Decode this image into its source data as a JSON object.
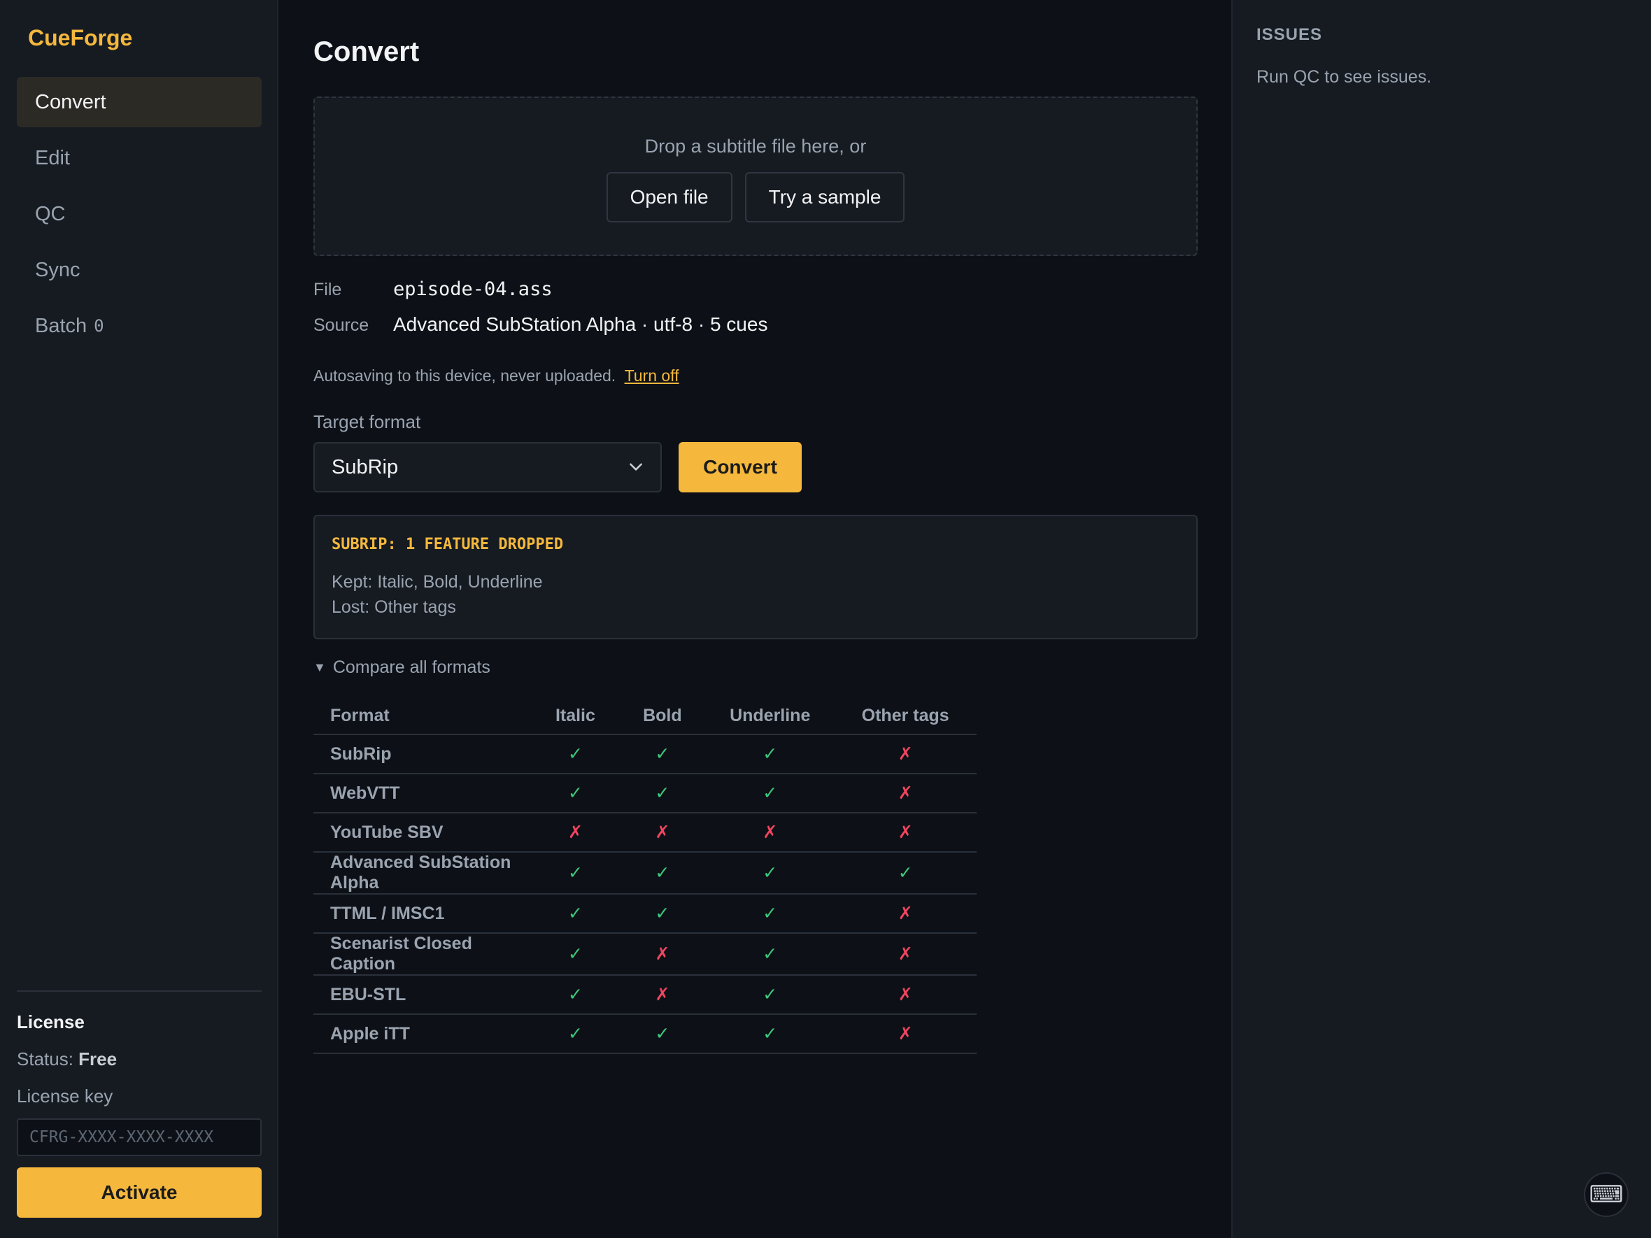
{
  "brand": "CueForge",
  "nav": [
    {
      "label": "Convert",
      "active": true
    },
    {
      "label": "Edit"
    },
    {
      "label": "QC"
    },
    {
      "label": "Sync"
    },
    {
      "label": "Batch",
      "badge": "0"
    }
  ],
  "license": {
    "title": "License",
    "status_label": "Status:",
    "status_value": "Free",
    "key_label": "License key",
    "key_placeholder": "CFRG-XXXX-XXXX-XXXX",
    "activate_label": "Activate"
  },
  "main": {
    "title": "Convert",
    "dropzone": {
      "text": "Drop a subtitle file here, or",
      "open_label": "Open file",
      "sample_label": "Try a sample"
    },
    "file_label": "File",
    "file_value": "episode-04.ass",
    "source_label": "Source",
    "source_value": "Advanced SubStation Alpha · utf-8 · 5 cues",
    "autosave_text": "Autosaving to this device, never uploaded.",
    "autosave_link": "Turn off",
    "target_label": "Target format",
    "target_value": "SubRip",
    "convert_label": "Convert",
    "report": {
      "title": "SUBRIP: 1 FEATURE DROPPED",
      "kept": "Kept: Italic, Bold, Underline",
      "lost": "Lost: Other tags"
    },
    "compare_label": "Compare all formats",
    "table": {
      "headers": [
        "Format",
        "Italic",
        "Bold",
        "Underline",
        "Other tags"
      ],
      "rows": [
        {
          "format": "SubRip",
          "cells": [
            "✓",
            "✓",
            "✓",
            "✗"
          ]
        },
        {
          "format": "WebVTT",
          "cells": [
            "✓",
            "✓",
            "✓",
            "✗"
          ]
        },
        {
          "format": "YouTube SBV",
          "cells": [
            "✗",
            "✗",
            "✗",
            "✗"
          ]
        },
        {
          "format": "Advanced SubStation Alpha",
          "cells": [
            "✓",
            "✓",
            "✓",
            "✓"
          ]
        },
        {
          "format": "TTML / IMSC1",
          "cells": [
            "✓",
            "✓",
            "✓",
            "✗"
          ]
        },
        {
          "format": "Scenarist Closed Caption",
          "cells": [
            "✓",
            "✗",
            "✓",
            "✗"
          ]
        },
        {
          "format": "EBU-STL",
          "cells": [
            "✓",
            "✗",
            "✓",
            "✗"
          ]
        },
        {
          "format": "Apple iTT",
          "cells": [
            "✓",
            "✓",
            "✓",
            "✗"
          ]
        }
      ]
    }
  },
  "issues": {
    "title": "ISSUES",
    "empty_text": "Run QC to see issues."
  },
  "keyboard_icon": "⌨",
  "colors": {
    "accent": "#f5b83d",
    "yes": "#3ec87a",
    "no": "#f0455f",
    "background": "#0d1117",
    "panel": "#161b22"
  }
}
